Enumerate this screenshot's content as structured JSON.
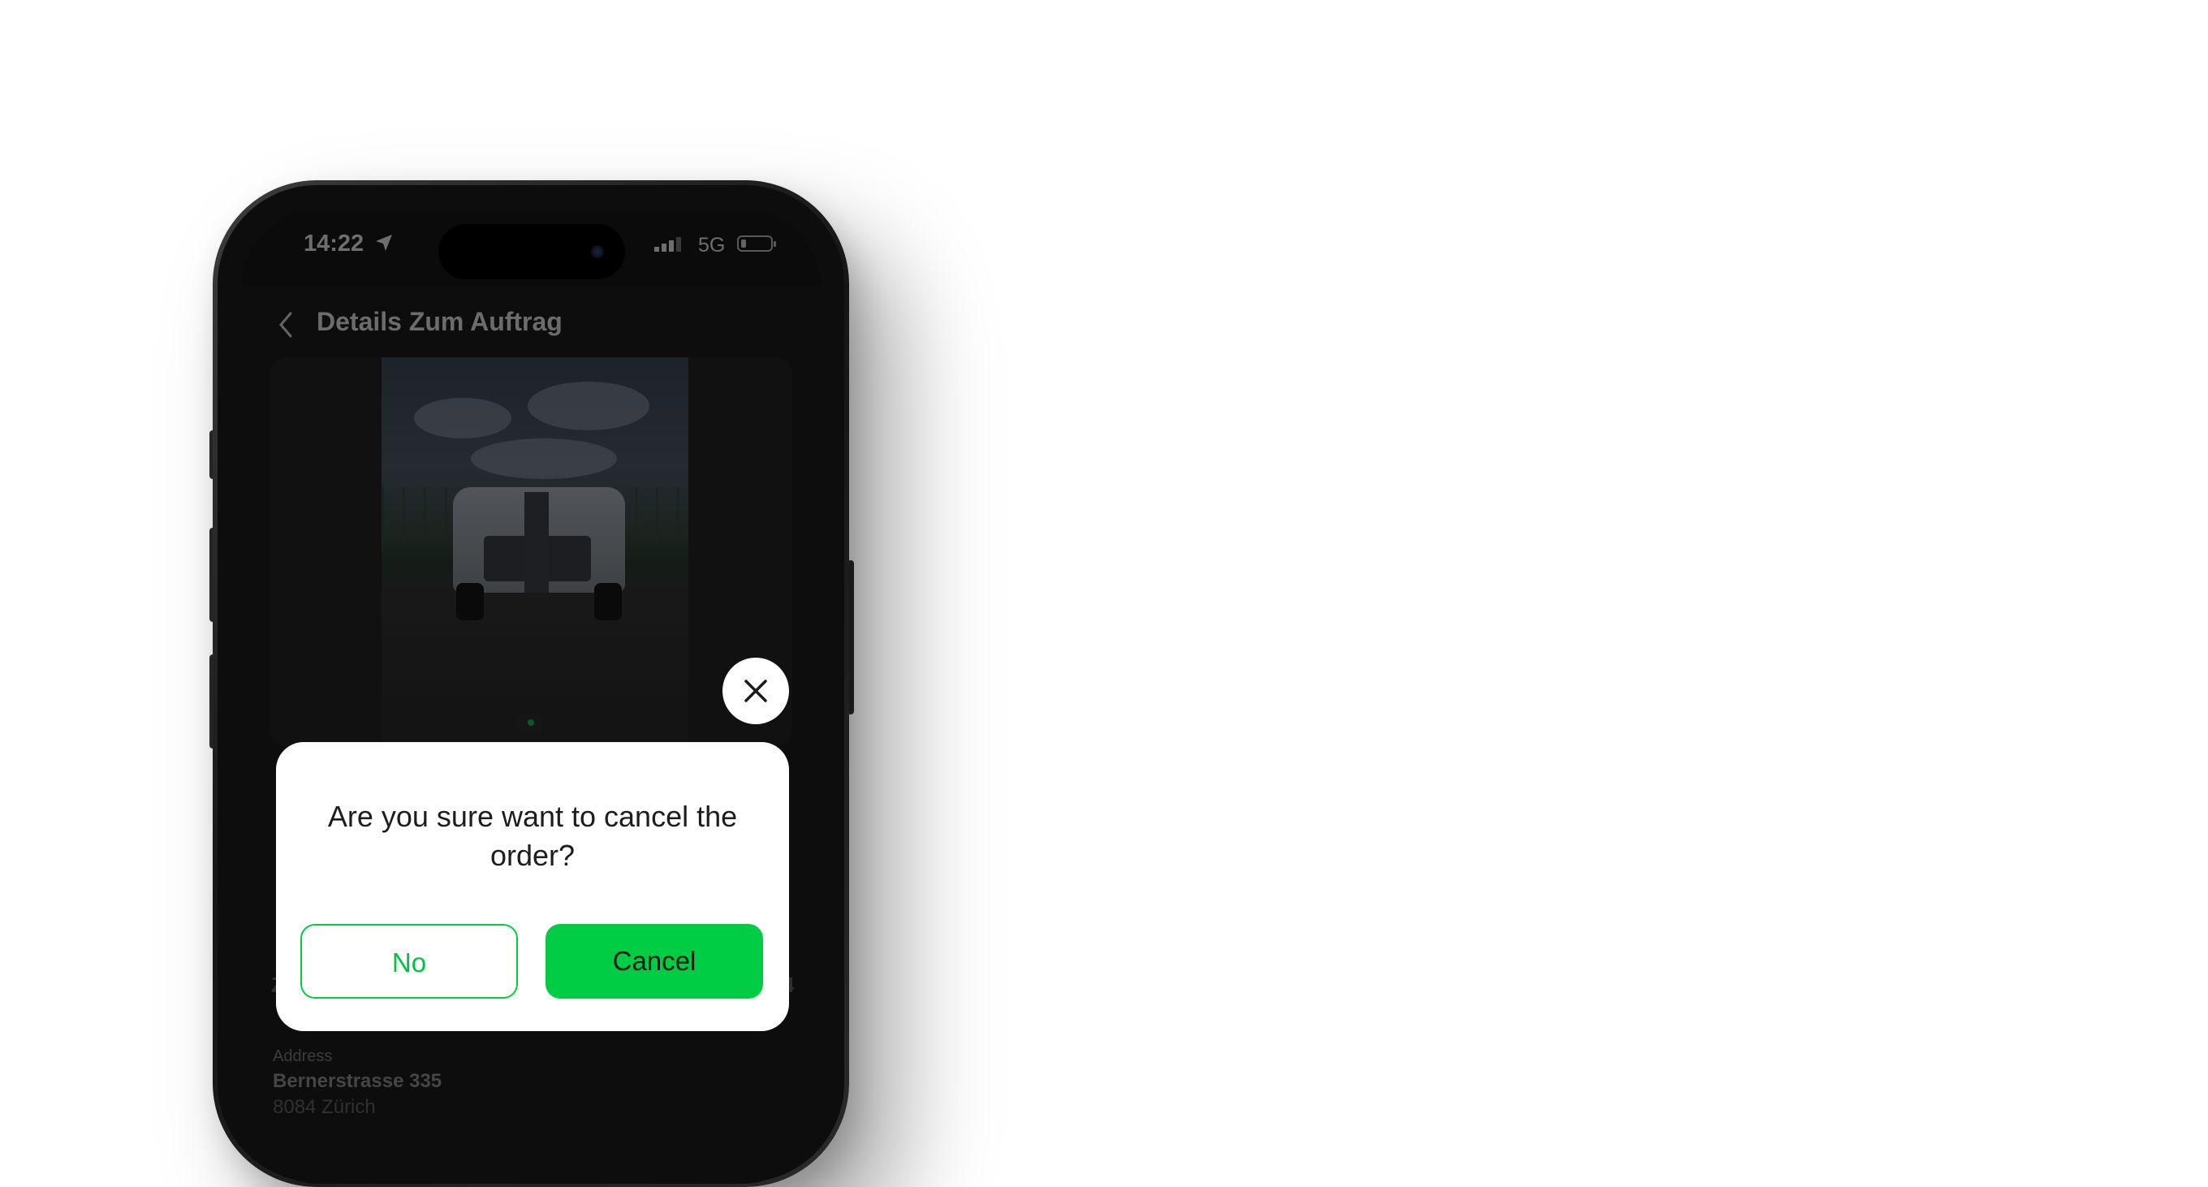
{
  "status_bar": {
    "time": "14:22",
    "network": "5G",
    "icons": [
      "location-arrow-icon",
      "signal-icon",
      "battery-icon"
    ]
  },
  "header": {
    "title": "Details Zum Auftrag",
    "back_icon": "chevron-left-icon"
  },
  "details": {
    "address_label": "Address",
    "street": "Bernerstrasse 335",
    "city": "8084 Zürich"
  },
  "dialog": {
    "message": "Are you sure want to cancel the order?",
    "no_label": "No",
    "cancel_label": "Cancel",
    "close_icon": "close-icon"
  },
  "colors": {
    "accent": "#00CC44",
    "dialog_bg": "#FFFFFF",
    "screen_bg": "#141414"
  }
}
